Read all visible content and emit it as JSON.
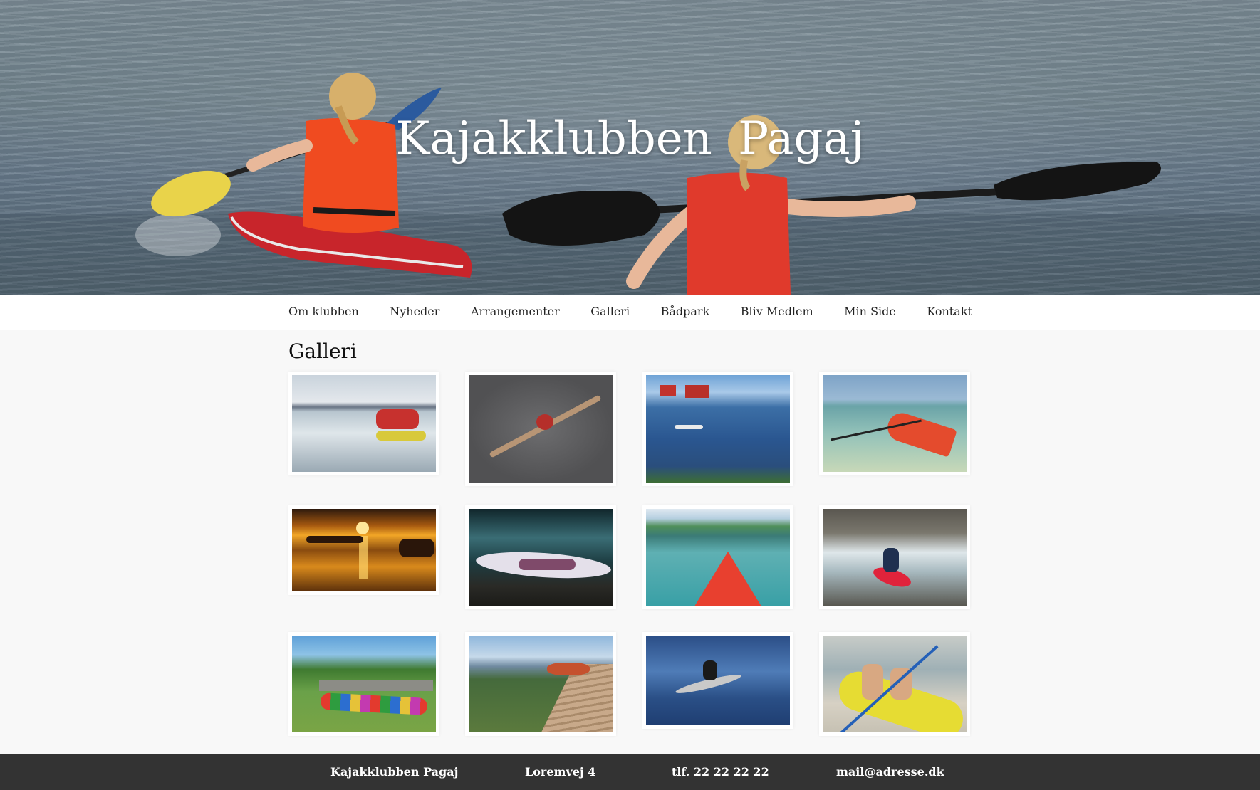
{
  "header": {
    "site_title": "Kajakklubben  Pagaj"
  },
  "nav": {
    "items": [
      {
        "label": "Om klubben",
        "active": true
      },
      {
        "label": "Nyheder",
        "active": false
      },
      {
        "label": "Arrangementer",
        "active": false
      },
      {
        "label": "Galleri",
        "active": false
      },
      {
        "label": "Bådpark",
        "active": false
      },
      {
        "label": "Bliv Medlem",
        "active": false
      },
      {
        "label": "Min Side",
        "active": false
      },
      {
        "label": "Kontakt",
        "active": false
      }
    ]
  },
  "main": {
    "title": "Galleri",
    "gallery": {
      "photo_count": 12
    }
  },
  "footer": {
    "name": "Kajakklubben Pagaj",
    "address": "Loremvej 4",
    "phone": "tlf. 22 22 22 22",
    "email": "mail@adresse.dk"
  },
  "colors": {
    "nav_underline": "#5a8aa8",
    "footer_bg": "#333333",
    "page_bg": "#f8f8f8"
  }
}
